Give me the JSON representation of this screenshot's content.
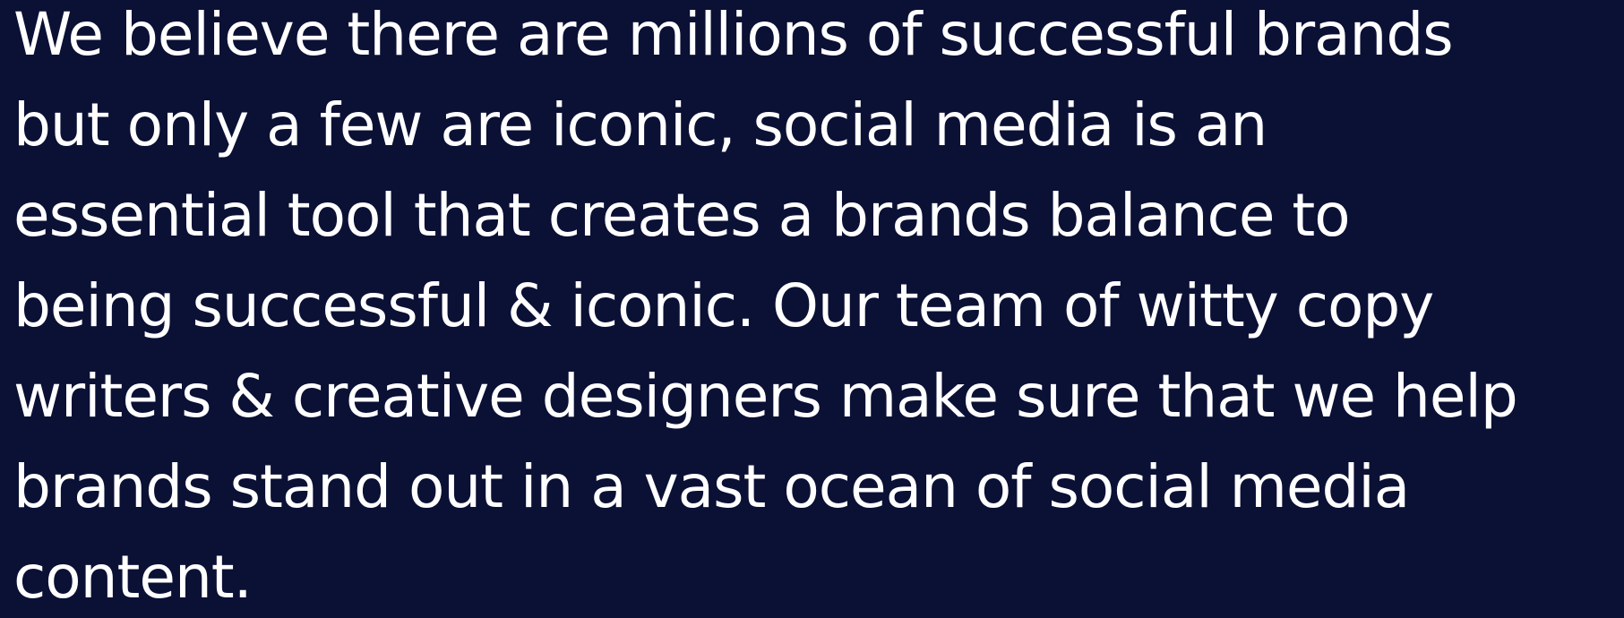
{
  "colors": {
    "background": "#0b1035",
    "text": "#ffffff"
  },
  "paragraph": {
    "lines": [
      "We believe there are millions of successful brands",
      "but only a few are iconic, social media is an",
      "essential tool that creates a brands balance to",
      "being successful & iconic. Our team of witty copy",
      "writers & creative designers make sure that we help",
      "brands stand out in a vast ocean of social media",
      "content."
    ]
  }
}
